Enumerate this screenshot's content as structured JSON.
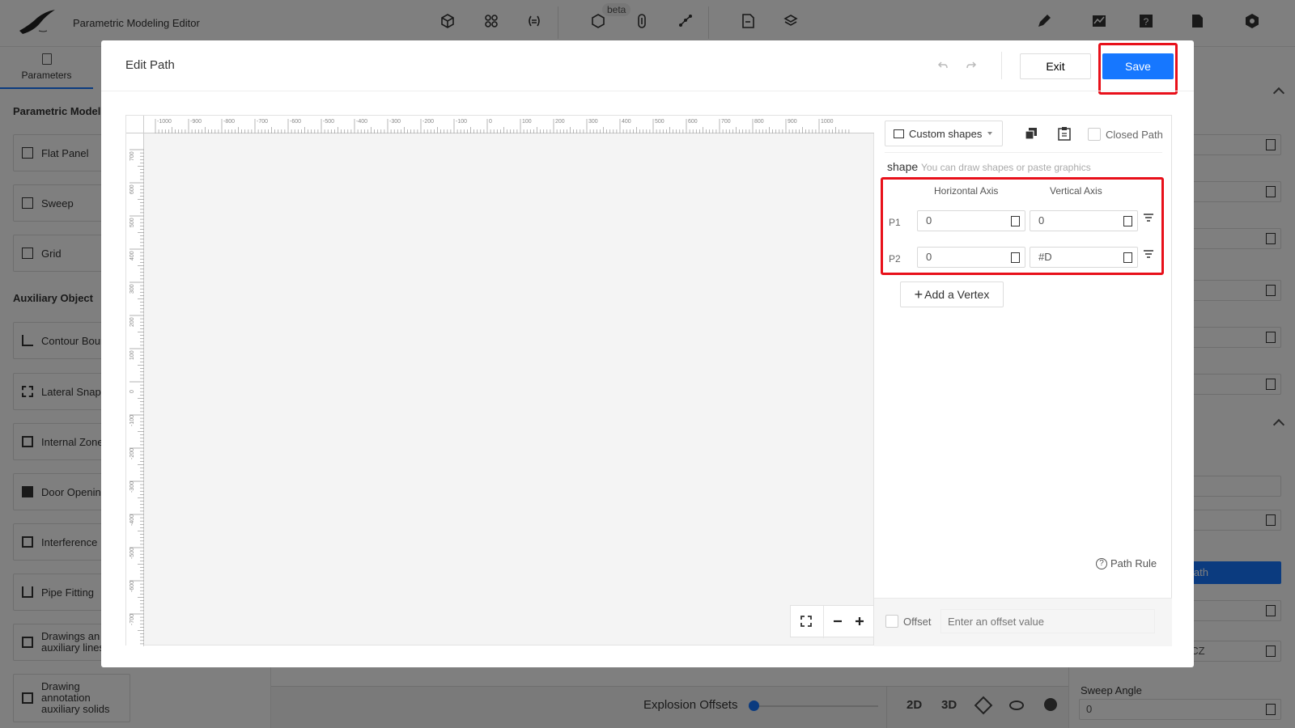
{
  "app": {
    "title": "Parametric Modeling Editor",
    "beta_badge": "beta",
    "logo_icon": "bird-logo-icon"
  },
  "left_panel": {
    "tab_label": "Parameters",
    "parametric_model_heading": "Parametric Model",
    "parametric_items": [
      "Flat Panel",
      "Sweep",
      "Grid"
    ],
    "auxiliary_heading": "Auxiliary Object",
    "auxiliary_items": [
      "Contour Boun",
      "Lateral Snap",
      "Internal Zone",
      "Door Openin",
      "Interference",
      "Pipe Fitting",
      "Drawings an auxiliary lines",
      "Drawing annotation auxiliary solids"
    ]
  },
  "right_panel": {
    "field_value_cz": "#CZ",
    "sweep_angle_label": "Sweep Angle",
    "sweep_angle_value": "0",
    "path_button_label": "ath"
  },
  "bottom_bar": {
    "explosion_label": "Explosion Offsets",
    "view_2d": "2D",
    "view_3d": "3D"
  },
  "modal": {
    "title": "Edit Path",
    "exit_label": "Exit",
    "save_label": "Save",
    "shape_selector": "Custom shapes",
    "closed_path_label": "Closed Path",
    "shape_label": "shape",
    "shape_hint": "You can draw shapes or paste graphics",
    "col_horizontal": "Horizontal Axis",
    "col_vertical": "Vertical Axis",
    "vertices": [
      {
        "label": "P1",
        "h": "0",
        "v": "0"
      },
      {
        "label": "P2",
        "h": "0",
        "v": "#D"
      }
    ],
    "add_vertex_label": "Add a Vertex",
    "path_rule_label": "Path Rule",
    "offset_label": "Offset",
    "offset_placeholder": "Enter an offset value",
    "ruler_top_ticks": [
      "-1000",
      "-900",
      "-800",
      "-700",
      "-600",
      "-500",
      "-400",
      "-300",
      "-200",
      "-100",
      "0",
      "100",
      "200",
      "300",
      "400",
      "500",
      "600",
      "700",
      "800",
      "900",
      "1000"
    ],
    "ruler_left_ticks": [
      "700",
      "600",
      "500",
      "400",
      "300",
      "200",
      "100",
      "0",
      "-100",
      "-200",
      "-300",
      "-400",
      "-500",
      "-600",
      "-700"
    ]
  },
  "colors": {
    "primary": "#1677ff",
    "highlight": "#e8101a",
    "overlay": "rgba(0,0,0,0.5)"
  }
}
